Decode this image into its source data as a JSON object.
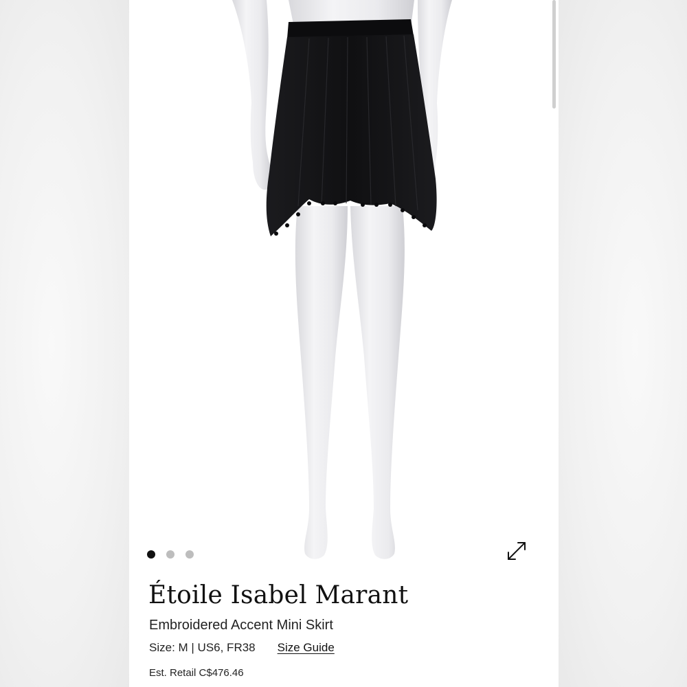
{
  "product": {
    "brand": "Étoile Isabel Marant",
    "name": "Embroidered Accent Mini Skirt",
    "size": "Size: M | US6, FR38",
    "size_guide_label": "Size Guide",
    "est_retail": "Est. Retail C$476.46"
  },
  "carousel": {
    "image_count": 3,
    "active_index": 0,
    "expand_icon": "expand-arrows-icon"
  },
  "colors": {
    "text": "#111111",
    "dot_active": "#111111",
    "dot_inactive": "#bdbdbd",
    "skirt": "#141416",
    "mannequin": "#ececef"
  }
}
